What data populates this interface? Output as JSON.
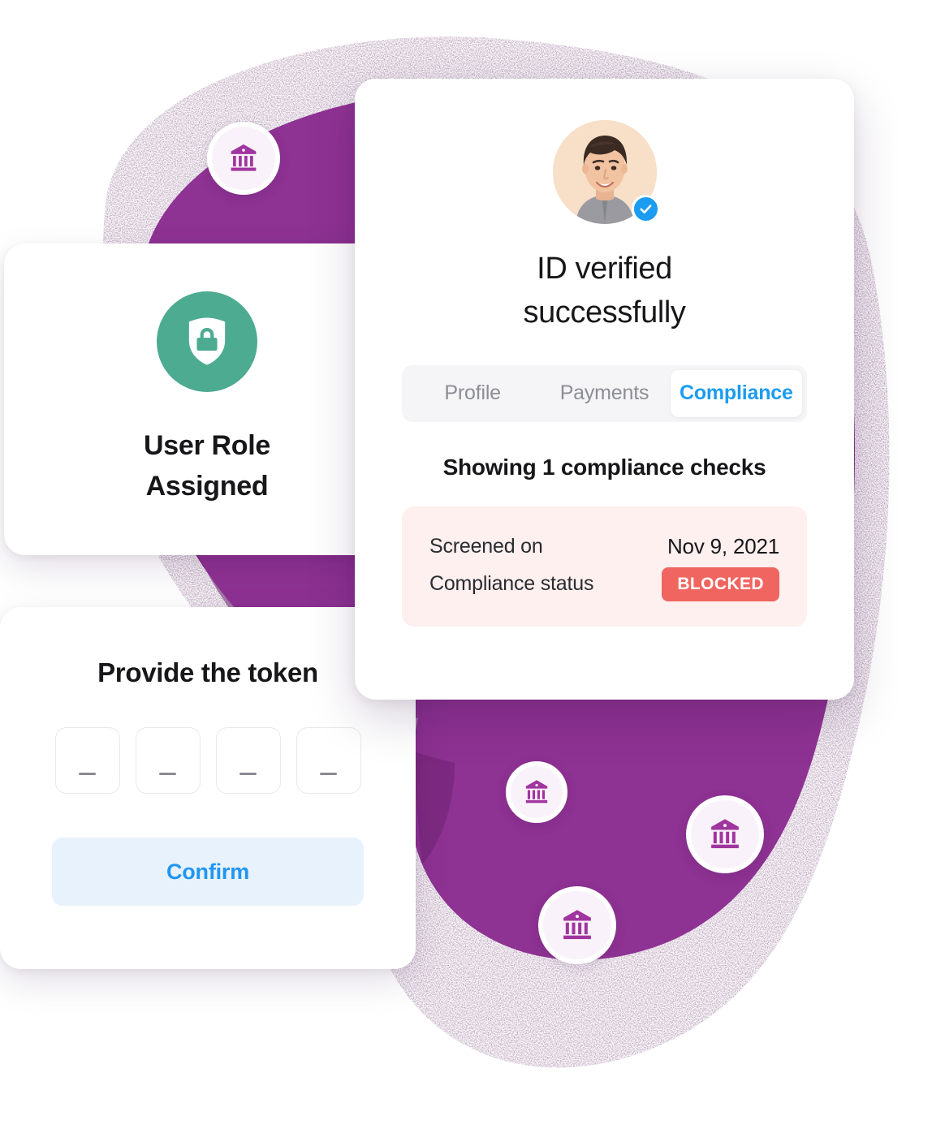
{
  "background": {
    "blob_color": "#8e3293",
    "blob_shadow_color": "#5d2560",
    "name": "purple-blob-backdrop"
  },
  "role_card": {
    "icon": "shield-lock-icon",
    "icon_circle_color": "#4cab91",
    "title_line1": "User Role",
    "title_line2": "Assigned"
  },
  "token_card": {
    "title": "Provide the token",
    "inputs": [
      {
        "name": "token-digit-1",
        "value": "",
        "placeholder": "–"
      },
      {
        "name": "token-digit-2",
        "value": "",
        "placeholder": "–"
      },
      {
        "name": "token-digit-3",
        "value": "",
        "placeholder": "–"
      },
      {
        "name": "token-digit-4",
        "value": "",
        "placeholder": "–"
      }
    ],
    "confirm_label": "Confirm",
    "confirm_text_color": "#2196f3",
    "confirm_bg_color": "#e8f2fd"
  },
  "verify_card": {
    "avatar": {
      "name": "user-avatar",
      "verified": true,
      "badge_icon": "check-badge-icon",
      "badge_color": "#1c9cf0"
    },
    "title_line1": "ID verified",
    "title_line2": "successfully",
    "tabs": [
      {
        "label": "Profile",
        "active": false
      },
      {
        "label": "Payments",
        "active": false
      },
      {
        "label": "Compliance",
        "active": true
      }
    ],
    "active_tab_color": "#1c9cf0",
    "results_summary": "Showing 1 compliance checks",
    "check_panel": {
      "bg_color": "#fdf0ef",
      "rows": [
        {
          "label": "Screened on",
          "value": "Nov 9, 2021",
          "type": "text"
        },
        {
          "label": "Compliance status",
          "value": "BLOCKED",
          "type": "badge",
          "badge_color": "#f0655f"
        }
      ]
    }
  },
  "bank_badges": [
    {
      "name": "bank-badge-1",
      "icon": "bank-icon"
    },
    {
      "name": "bank-badge-2",
      "icon": "bank-icon"
    },
    {
      "name": "bank-badge-3",
      "icon": "bank-icon"
    },
    {
      "name": "bank-badge-4",
      "icon": "bank-icon"
    }
  ]
}
